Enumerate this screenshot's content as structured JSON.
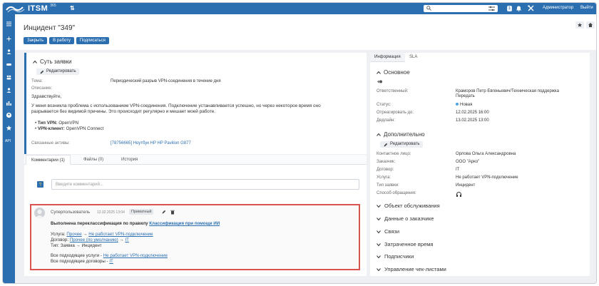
{
  "topbar": {
    "logo_text": "ITSM",
    "logo_sup": "365",
    "sort_symbol": "⇅",
    "badge": "1",
    "user": "Администратор",
    "exit": "Выйти"
  },
  "sidebar": {
    "api_label": "API"
  },
  "header": {
    "title": "Инцидент \"349\"",
    "buttons": [
      "Закрыть",
      "В работу",
      "Подписаться"
    ]
  },
  "essence": {
    "title": "Суть заявки",
    "edit": "Редактировать",
    "topic_label": "Тема:",
    "topic_value": "Периодический разрыв VPN-соединения в течение дня",
    "desc_label": "Описание:",
    "greeting": "Здравствуйте,",
    "desc_line1": "У меня возникла проблема с использованием VPN-соединения. Подключение устанавливается успешно, но через некоторое время оно",
    "desc_line2": "разрывается без видимой причины. Это происходит регулярно и мешает моей работе.",
    "bullet1_label": "Тип VPN:",
    "bullet1_value": " OpenVPN",
    "bullet2_label": "VPN-клиент:",
    "bullet2_value": " OpenVPN Connect",
    "assets_label": "Связанные активы:",
    "assets_value": "[78756665] Ноутбук HP HP Pavilion G877"
  },
  "tabs": {
    "items": [
      "Комментарии (1)",
      "Файлы (0)",
      "История"
    ],
    "comment_placeholder": "Введите комментарий..."
  },
  "comment": {
    "author": "Суперпользователь",
    "date": "12.02.2025 13:04",
    "badge": "Приватный",
    "headline_prefix": "Выполнена переклассификация по правилу ",
    "headline_link": "Классификация при помощи ИИ",
    "service_label": "Услуга: ",
    "service_from": "Прочее",
    "service_to": "Не работает VPN-подключение",
    "contract_label": "Договор: ",
    "contract_from": "Прочее (по умолчанию)",
    "contract_to": "IT",
    "type_line": "Тип: Заявка → Инцидент",
    "all_services_prefix": "Все подходящие услуги - ",
    "all_services_link": "Не работает VPN-подключение",
    "all_contracts_prefix": "Все подходящие договоры - ",
    "all_contracts_link": "IT",
    "arrow": " → "
  },
  "right": {
    "tabs": [
      "Информация",
      "SLA"
    ],
    "basic_title": "Основное",
    "responsible_label": "Ответственный:",
    "responsible_value": "Краморов Петр Евгеньевич/Техническая поддержка",
    "transfer": "Передать",
    "status_label": "Статус:",
    "status_value": "Новая",
    "respond_label": "Отреагировать до:",
    "respond_value": "12.02.2025 16:00",
    "deadline_label": "Дедлайн:",
    "deadline_value": "13.02.2025 13:00",
    "extra_title": "Дополнительно",
    "edit": "Редактировать",
    "contact_label": "Контактное лицо:",
    "contact_value": "Орлова Ольга Александровна",
    "customer_label": "Заказчик:",
    "customer_value": "ООО \"Арко\"",
    "contract_label": "Договор:",
    "contract_value": "IT",
    "service_label": "Услуга:",
    "service_value": "Не работает VPN-подключение",
    "type_label": "Тип заявки:",
    "type_value": "Инцидент",
    "channel_label": "Способ обращения:",
    "sections": [
      "Объект обслуживания",
      "Данные о заказчике",
      "Связи",
      "Затраченное время",
      "Подписчики",
      "Управление чек-листами"
    ]
  },
  "colors": {
    "brand": "#2c6fb0",
    "highlight": "#d9534f",
    "status": "#4fa3e0"
  }
}
